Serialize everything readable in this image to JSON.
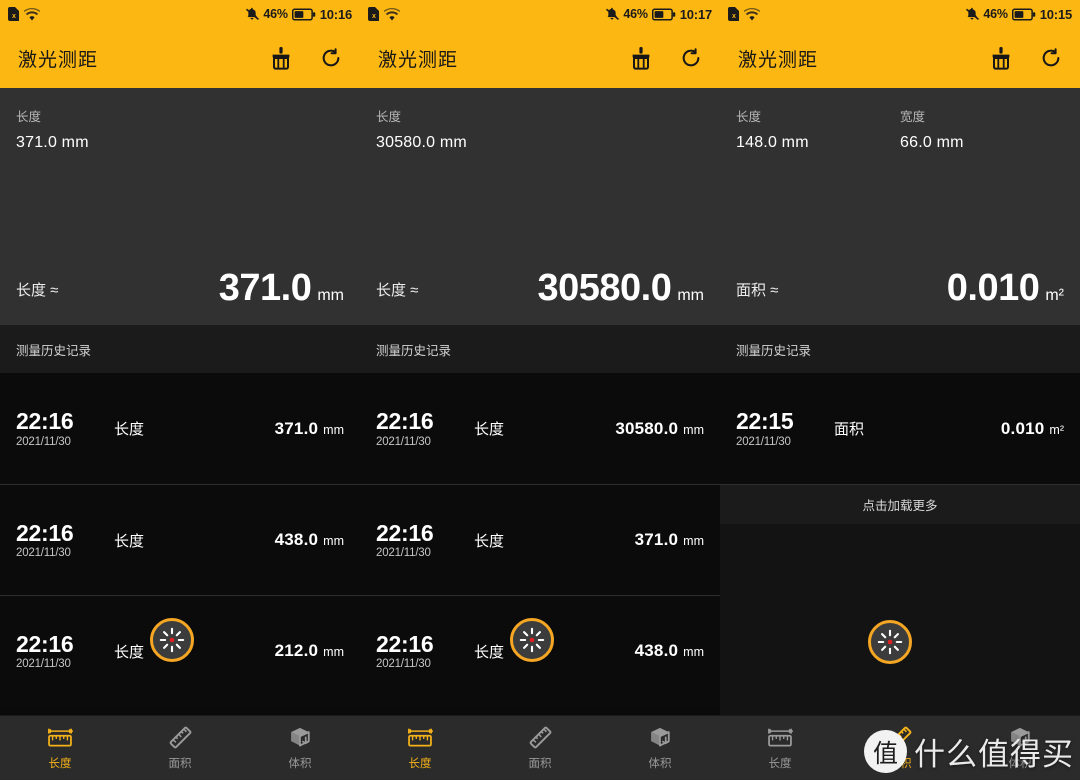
{
  "app": {
    "title": "激光测距",
    "accent_color": "#FCB713",
    "panel_bg": "#313131",
    "history_bg": "#0b0b0b",
    "spinner_ring_color": "#F5A623",
    "nav_active_color": "#F5B21A"
  },
  "icons": {
    "sdcard": "sdcard-icon",
    "wifi": "wifi-icon",
    "mute": "mute-bell-icon",
    "battery": "battery-icon",
    "clear": "broom-clear-icon",
    "refresh": "refresh-icon",
    "spinner": "loading-spinner-icon",
    "length": "ruler-length-icon",
    "area": "ruler-area-icon",
    "volume": "cube-volume-icon"
  },
  "nav": {
    "items": [
      {
        "label": "长度",
        "icon": "ruler-length-icon"
      },
      {
        "label": "面积",
        "icon": "ruler-area-icon"
      },
      {
        "label": "体积",
        "icon": "cube-volume-icon"
      }
    ]
  },
  "labels": {
    "history_title": "测量历史记录",
    "load_more": "点击加载更多",
    "battery_pct": "46%"
  },
  "watermark": {
    "badge": "值",
    "text": "什么值得买"
  },
  "panels": [
    {
      "status": {
        "time": "10:16",
        "battery": "46%"
      },
      "dims": [
        {
          "label": "长度",
          "value": "371.0 mm"
        }
      ],
      "result": {
        "label": "长度 ≈",
        "value": "371.0",
        "unit": "mm"
      },
      "history_title": "测量历史记录",
      "history": [
        {
          "time": "22:16",
          "date": "2021/11/30",
          "type": "长度",
          "value": "371.0",
          "unit": "mm"
        },
        {
          "time": "22:16",
          "date": "2021/11/30",
          "type": "长度",
          "value": "438.0",
          "unit": "mm"
        },
        {
          "time": "22:16",
          "date": "2021/11/30",
          "type": "长度",
          "value": "212.0",
          "unit": "mm"
        }
      ],
      "load_more": null,
      "active_nav": "长度"
    },
    {
      "status": {
        "time": "10:17",
        "battery": "46%"
      },
      "dims": [
        {
          "label": "长度",
          "value": "30580.0 mm"
        }
      ],
      "result": {
        "label": "长度 ≈",
        "value": "30580.0",
        "unit": "mm"
      },
      "history_title": "测量历史记录",
      "history": [
        {
          "time": "22:16",
          "date": "2021/11/30",
          "type": "长度",
          "value": "30580.0",
          "unit": "mm"
        },
        {
          "time": "22:16",
          "date": "2021/11/30",
          "type": "长度",
          "value": "371.0",
          "unit": "mm"
        },
        {
          "time": "22:16",
          "date": "2021/11/30",
          "type": "长度",
          "value": "438.0",
          "unit": "mm"
        }
      ],
      "load_more": null,
      "active_nav": "长度"
    },
    {
      "status": {
        "time": "10:15",
        "battery": "46%"
      },
      "dims": [
        {
          "label": "长度",
          "value": "148.0 mm"
        },
        {
          "label": "宽度",
          "value": "66.0 mm"
        }
      ],
      "result": {
        "label": "面积 ≈",
        "value": "0.010",
        "unit": "m²"
      },
      "history_title": "测量历史记录",
      "history": [
        {
          "time": "22:15",
          "date": "2021/11/30",
          "type": "面积",
          "value": "0.010",
          "unit": "m²"
        }
      ],
      "load_more": "点击加载更多",
      "active_nav": "面积"
    }
  ]
}
